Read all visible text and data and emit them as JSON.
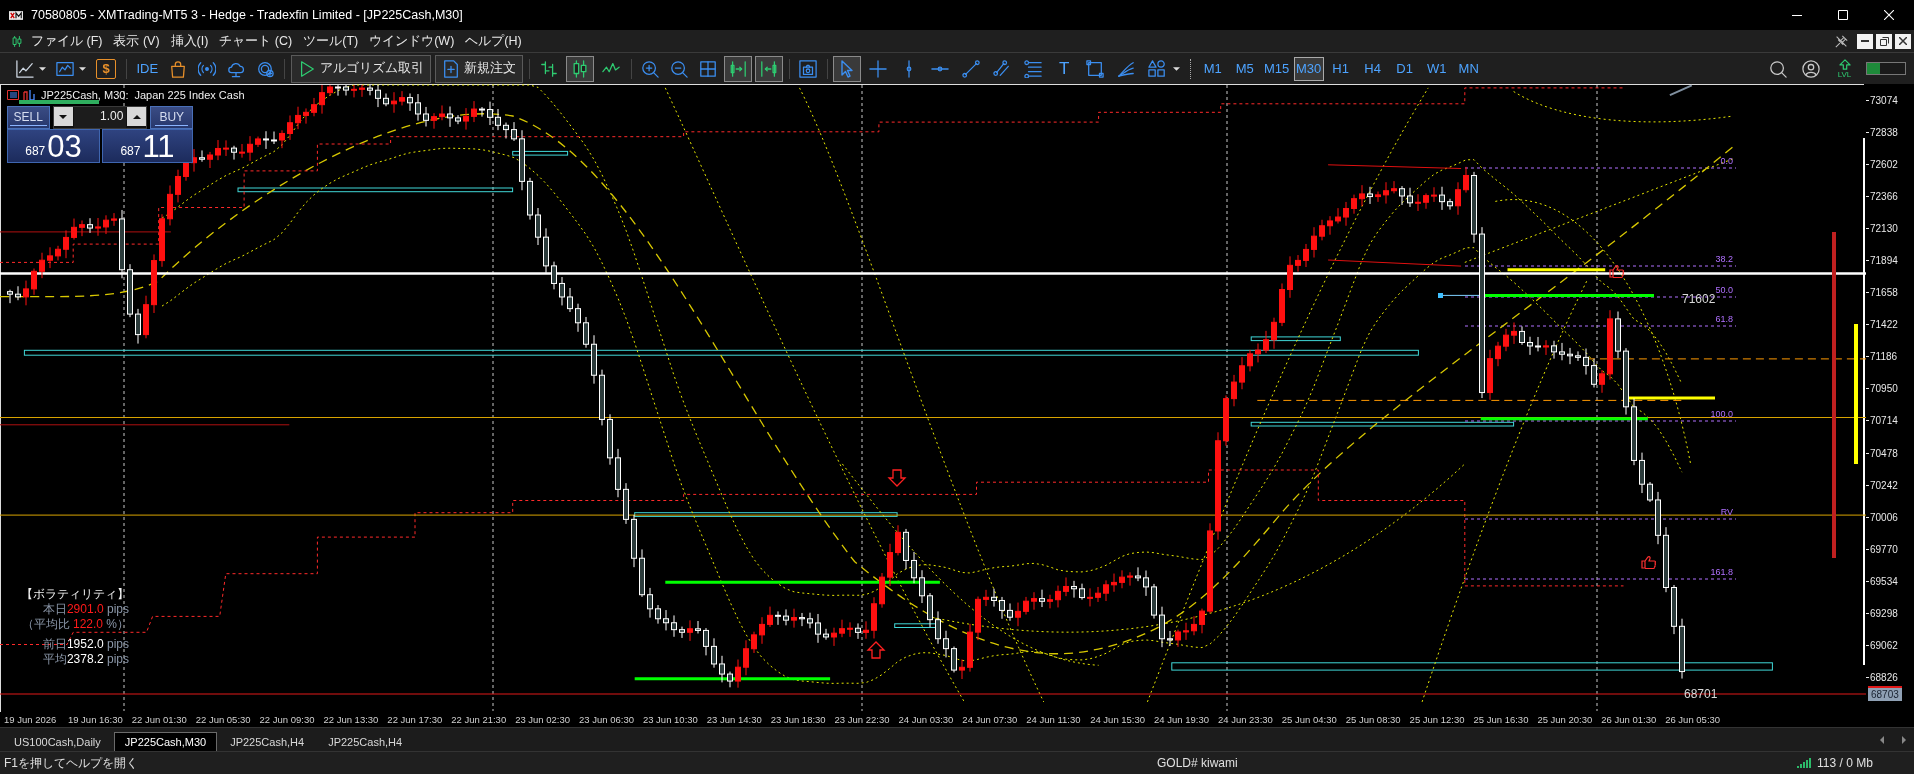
{
  "window": {
    "title": "70580805 - XMTrading-MT5 3 - Hedge - Tradexfin Limited - [JP225Cash,M30]"
  },
  "menu": [
    {
      "label": "ファイル (F)"
    },
    {
      "label": "表示 (V)"
    },
    {
      "label": "挿入(I)"
    },
    {
      "label": "チャート (C)"
    },
    {
      "label": "ツール(T)"
    },
    {
      "label": "ウインドウ(W)"
    },
    {
      "label": "ヘルプ(H)"
    }
  ],
  "toolbar": {
    "groups": [
      [
        {
          "kind": "chart_menu"
        },
        {
          "kind": "indicator_menu"
        },
        {
          "kind": "dollar",
          "label": "$"
        }
      ],
      [
        {
          "kind": "ide",
          "label": "IDE"
        },
        {
          "kind": "market"
        },
        {
          "kind": "signals"
        },
        {
          "kind": "cloud"
        },
        {
          "kind": "vps"
        }
      ],
      [
        {
          "kind": "algo",
          "label": "アルゴリズム取引"
        },
        {
          "kind": "new_order",
          "label": "新規注文"
        }
      ],
      [
        {
          "kind": "bars",
          "selected": false
        },
        {
          "kind": "candles",
          "selected": true
        },
        {
          "kind": "line",
          "selected": false
        }
      ],
      [
        {
          "kind": "zoom_in"
        },
        {
          "kind": "zoom_out"
        },
        {
          "kind": "tile"
        }
      ],
      [
        {
          "kind": "auto_scroll",
          "on": true
        },
        {
          "kind": "chart_shift",
          "on": true
        }
      ],
      [
        {
          "kind": "screenshot"
        }
      ],
      [
        {
          "kind": "cursor",
          "selected": true
        },
        {
          "kind": "crosshair",
          "selected": false
        },
        {
          "kind": "vertical_line",
          "selected": false
        },
        {
          "kind": "horizontal_line",
          "selected": false
        },
        {
          "kind": "trend_line",
          "selected": false
        },
        {
          "kind": "channel",
          "selected": false
        },
        {
          "kind": "fibonacci",
          "selected": false
        },
        {
          "kind": "text",
          "label": "T",
          "selected": false
        },
        {
          "kind": "rectangle",
          "selected": false
        },
        {
          "kind": "fan",
          "selected": false
        },
        {
          "kind": "shapes_menu",
          "selected": false
        }
      ]
    ],
    "timeframes": [
      {
        "label": "M1",
        "selected": false
      },
      {
        "label": "M5",
        "selected": false
      },
      {
        "label": "M15",
        "selected": false
      },
      {
        "label": "M30",
        "selected": true
      },
      {
        "label": "H1",
        "selected": false
      },
      {
        "label": "H4",
        "selected": false
      },
      {
        "label": "D1",
        "selected": false
      },
      {
        "label": "W1",
        "selected": false
      },
      {
        "label": "MN",
        "selected": false
      }
    ],
    "right_items": [
      {
        "kind": "search"
      },
      {
        "kind": "account"
      },
      {
        "kind": "level",
        "label": "LVL"
      }
    ],
    "level_bar": {
      "level": 0.35
    }
  },
  "chart": {
    "symbol": "JP225Cash, M30:",
    "description": "Japan 225 Index Cash",
    "trade_panel": {
      "sell_label": "SELL",
      "buy_label": "BUY",
      "lot": "1.00",
      "sell_price": {
        "prefix": "687",
        "big": "03"
      },
      "buy_price": {
        "prefix": "687",
        "big": "11"
      }
    },
    "volatility": {
      "title": "【ボラティリティ】",
      "lines": [
        {
          "label": "本日",
          "value": "2901.0",
          "unit": "pips",
          "color": "#ff1a1a"
        },
        {
          "label": "（平均比 ",
          "value": "122.0",
          "unit": "%）",
          "color": "#ff1a1a"
        },
        {
          "label": "前日",
          "value": "1952.0",
          "unit": "pips",
          "color": "#ffffff"
        },
        {
          "label": "平均",
          "value": "2378.2",
          "unit": "pips",
          "color": "#ffffff"
        }
      ]
    },
    "line_labels": [
      {
        "text": "71602"
      },
      {
        "text": "68701"
      }
    ],
    "fib_levels": [
      {
        "label": "0.0"
      },
      {
        "label": "38.2"
      },
      {
        "label": "50.0"
      },
      {
        "label": "61.8"
      },
      {
        "label": "100.0"
      },
      {
        "label": "RV"
      },
      {
        "label": "161.8"
      }
    ],
    "price_axis": [
      "73074",
      "72838",
      "72602",
      "72366",
      "72130",
      "71894",
      "71658",
      "71422",
      "71186",
      "70950",
      "70714",
      "70478",
      "70242",
      "70006",
      "69770",
      "69534",
      "69298",
      "69062",
      "68826"
    ],
    "current_price": "68703",
    "time_axis": [
      "19 Jun 2026",
      "19 Jun 16:30",
      "22 Jun 01:30",
      "22 Jun 05:30",
      "22 Jun 09:30",
      "22 Jun 13:30",
      "22 Jun 17:30",
      "22 Jun 21:30",
      "23 Jun 02:30",
      "23 Jun 06:30",
      "23 Jun 10:30",
      "23 Jun 14:30",
      "23 Jun 18:30",
      "23 Jun 22:30",
      "24 Jun 03:30",
      "24 Jun 07:30",
      "24 Jun 11:30",
      "24 Jun 15:30",
      "24 Jun 19:30",
      "24 Jun 23:30",
      "25 Jun 04:30",
      "25 Jun 08:30",
      "25 Jun 12:30",
      "25 Jun 16:30",
      "25 Jun 20:30",
      "26 Jun 01:30",
      "26 Jun 05:30"
    ]
  },
  "tabs": [
    {
      "label": "US100Cash,Daily",
      "selected": false
    },
    {
      "label": "JP225Cash,M30",
      "selected": true
    },
    {
      "label": "JP225Cash,H4",
      "selected": false
    },
    {
      "label": "JP225Cash,H4",
      "selected": false
    }
  ],
  "status_bar": {
    "help": "F1を押してヘルプを開く",
    "profile": "GOLD# kiwami",
    "traffic": "113 / 0 Mb"
  }
}
